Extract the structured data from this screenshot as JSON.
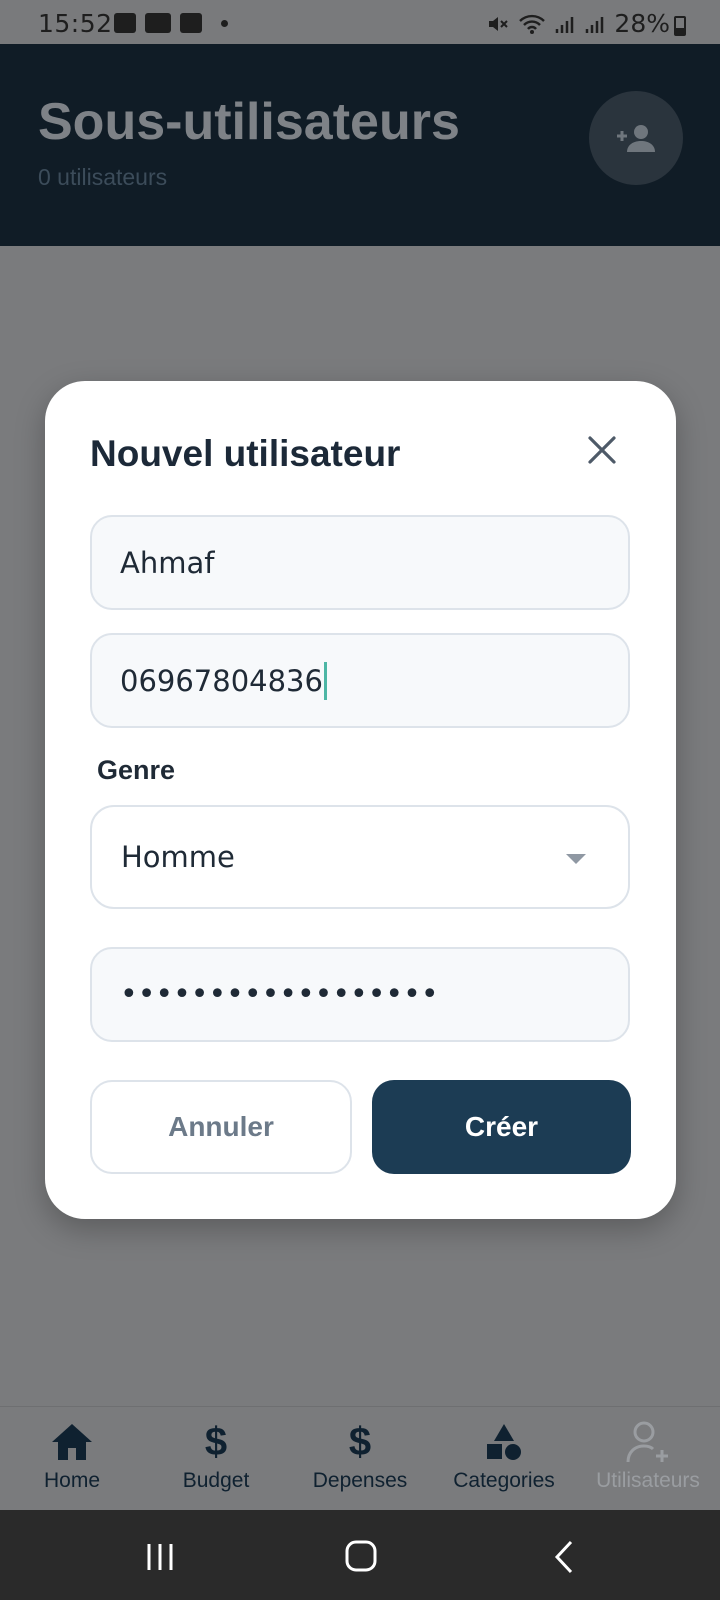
{
  "status_bar": {
    "time": "15:52",
    "battery": "28%",
    "icons": [
      "gallery-icon",
      "youtube-icon",
      "check-icon",
      "dot-icon",
      "mute-icon",
      "wifi-icon",
      "signal-icon",
      "signal-icon",
      "battery-icon"
    ]
  },
  "header": {
    "title": "Sous-utilisateurs",
    "subtitle": "0 utilisateurs",
    "add_user_icon": "person-add-icon"
  },
  "modal": {
    "title": "Nouvel utilisateur",
    "name_value": "Ahmaf",
    "phone_value": "06967804836",
    "genre_label": "Genre",
    "genre_value": "Homme",
    "password_value": "••••••••••••••••••",
    "cancel_label": "Annuler",
    "create_label": "Créer"
  },
  "bottom_nav": {
    "items": [
      {
        "label": "Home",
        "icon": "home-icon"
      },
      {
        "label": "Budget",
        "icon": "dollar-icon"
      },
      {
        "label": "Depenses",
        "icon": "dollar-icon"
      },
      {
        "label": "Categories",
        "icon": "shapes-icon"
      },
      {
        "label": "Utilisateurs",
        "icon": "person-add-outline-icon"
      }
    ]
  },
  "colors": {
    "header_bg": "#101c26",
    "primary_button": "#1c3c54",
    "caret": "#4db6a5"
  }
}
